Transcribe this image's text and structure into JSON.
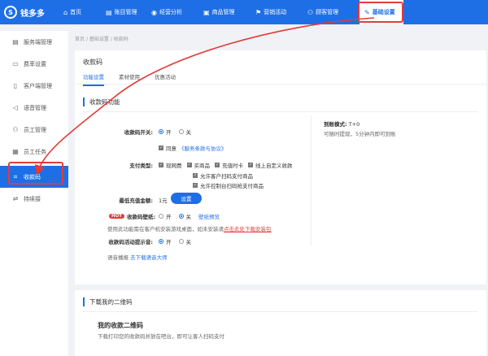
{
  "app": {
    "logo_text": "钱多多",
    "logo_mark": "S"
  },
  "nav": [
    {
      "label": "首页",
      "icon": "⌂"
    },
    {
      "label": "账目管理",
      "icon": "▤"
    },
    {
      "label": "经营分析",
      "icon": "◉"
    },
    {
      "label": "商品管理",
      "icon": "▣"
    },
    {
      "label": "营销活动",
      "icon": "⚑"
    },
    {
      "label": "顾客管理",
      "icon": "⚇"
    },
    {
      "label": "基础设置",
      "icon": "✎"
    }
  ],
  "sidebar": [
    {
      "label": "服务端管理",
      "icon": "▤"
    },
    {
      "label": "费率设置",
      "icon": "▭"
    },
    {
      "label": "客户端管理",
      "icon": "▯"
    },
    {
      "label": "语音管理",
      "icon": "◁"
    },
    {
      "label": "员工管理",
      "icon": "⚇"
    },
    {
      "label": "员工任务",
      "icon": "▦"
    },
    {
      "label": "收款码",
      "icon": "⌗"
    },
    {
      "label": "持续接",
      "icon": "⇌"
    }
  ],
  "breadcrumb": {
    "home": "首页",
    "sep1": "/",
    "mid": "基础设置",
    "sep2": "/",
    "current": "收款码"
  },
  "panel": {
    "title": "收款码",
    "tabs": [
      "功能设置",
      "素材使用",
      "优惠活动"
    ],
    "section_title": "收款码功能",
    "switch": {
      "label": "收款码开关:",
      "on": "开",
      "off": "关"
    },
    "agree": {
      "text": "同意",
      "link": "《服务条款与协议》"
    },
    "pay_types": {
      "label": "支付类型:",
      "options": [
        "现网费",
        "买商品",
        "充值时卡",
        "线上自定义收款"
      ],
      "extra1": "允许客户扫码支付商品",
      "extra2": "允许控制台扫码抢支付商品"
    },
    "min_amount": {
      "label": "最低充值金额:",
      "value": "1元",
      "button": "设置"
    },
    "wallpaper": {
      "hot": "HOT",
      "label": "收款码壁纸:",
      "on": "开",
      "off": "关",
      "link": "壁纸预览"
    },
    "wallpaper_note": {
      "text": "使用此功能需在客户机安装游戏桌面，如未安装请",
      "link": "点击此处下载安装包"
    },
    "prompt": {
      "label": "收款码活动提示音:",
      "on": "开",
      "off": "关"
    },
    "voice": {
      "text": "语音播报",
      "link": "去下载语音大师"
    },
    "right": {
      "label": "到账模式:",
      "value": "T+0",
      "sub": "可随时提现，5分钟内即可到账"
    }
  },
  "qr_panel": {
    "section_title": "下载我的二维码",
    "title": "我的收款二维码",
    "sub": "下载打印您的收款码并放在吧台，即可让客人扫码支付"
  },
  "colors": {
    "primary": "#1e6fe6",
    "highlight": "#e23b3b"
  }
}
